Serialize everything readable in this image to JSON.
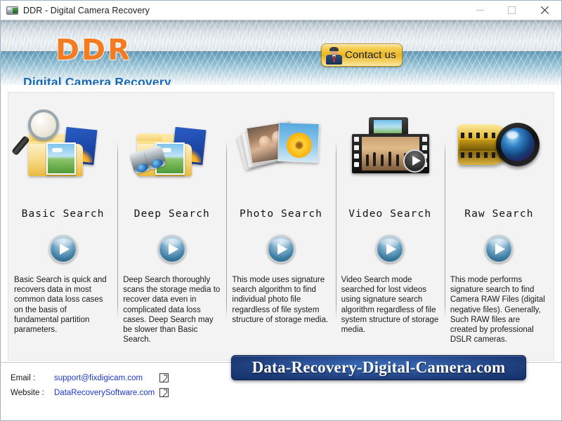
{
  "window": {
    "title": "DDR - Digital Camera Recovery",
    "icon": "camera-icon",
    "minimize_label": "",
    "maximize_label": "",
    "close_label": ""
  },
  "header": {
    "logo": "DDR",
    "subtitle": "Digital Camera Recovery",
    "contact_button": {
      "label": "Contact us",
      "icon": "person-icon"
    }
  },
  "modes": [
    {
      "label": "Basic Search",
      "icon": "magnifier-folder-icon",
      "description": "Basic Search is quick and recovers data in most common data loss cases on the basis of fundamental partition parameters.",
      "action_icon": "play-icon"
    },
    {
      "label": "Deep Search",
      "icon": "binoculars-folder-icon",
      "description": "Deep Search thoroughly scans the storage media to recover data even in complicated data loss cases. Deep Search may be slower than Basic Search.",
      "action_icon": "play-icon"
    },
    {
      "label": "Photo Search",
      "icon": "photo-stack-icon",
      "description": "This mode uses signature search algorithm to find individual photo file regardless of file system structure of storage media.",
      "action_icon": "play-icon"
    },
    {
      "label": "Video Search",
      "icon": "filmstrip-video-icon",
      "description": "Video Search mode searched for lost videos using signature search algorithm regardless of file system structure of storage media.",
      "action_icon": "play-icon"
    },
    {
      "label": "Raw Search",
      "icon": "film-reel-lens-icon",
      "description": "This mode performs signature search to find Camera RAW Files (digital negative files). Generally, Such RAW files are created by professional DSLR cameras.",
      "action_icon": "play-icon"
    }
  ],
  "footer": {
    "email_label": "Email :",
    "email_value": "support@fixdigicam.com",
    "email_link_icon": "external-link-icon",
    "website_label": "Website :",
    "website_value": "DataRecoverySoftware.com",
    "website_link_icon": "external-link-icon",
    "site_banner": "Data-Recovery-Digital-Camera.com"
  },
  "colors": {
    "logo_orange": "#f47b20",
    "subtitle_blue": "#1769b5",
    "link_blue": "#1b39c9",
    "banner_blue": "#2b539a",
    "contact_gold": "#e9b51f"
  }
}
